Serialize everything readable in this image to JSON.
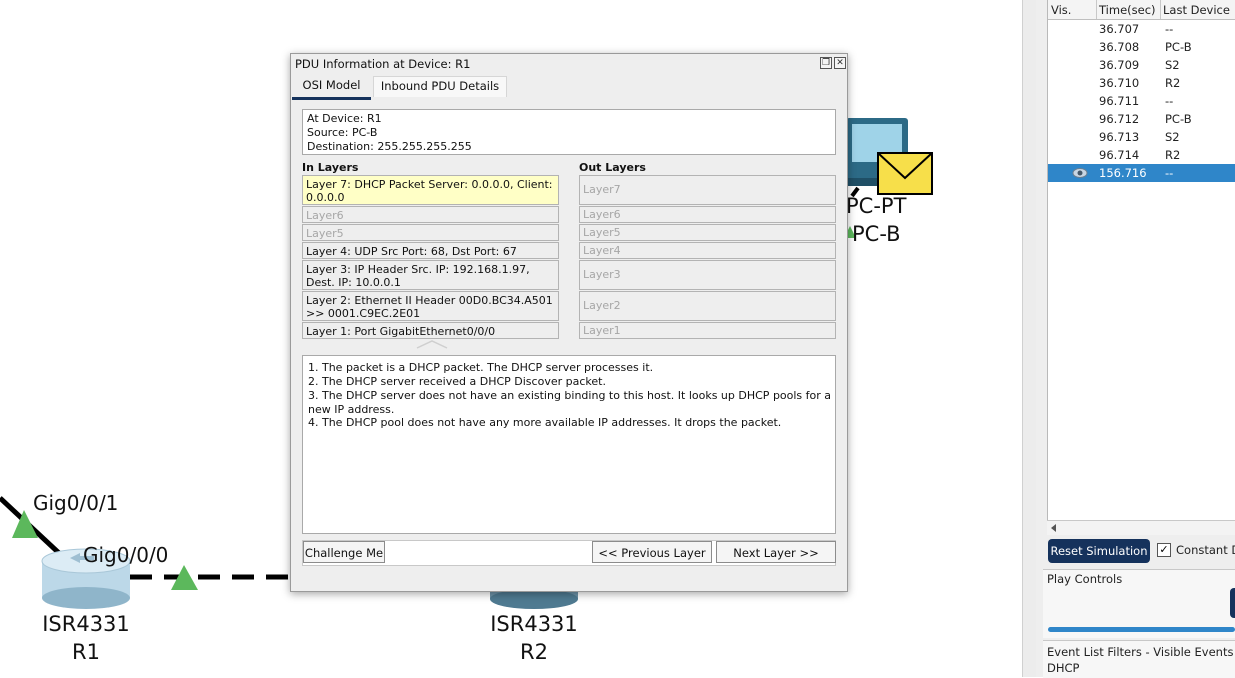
{
  "topology": {
    "devices": [
      {
        "model": "ISR4331",
        "name": "R1"
      },
      {
        "model": "ISR4331",
        "name": "R2"
      },
      {
        "model": "PC-PT",
        "name": "PC-B"
      }
    ],
    "ports": {
      "gig001": "Gig0/0/1",
      "gig000": "Gig0/0/0"
    },
    "colors": {
      "link": "#000000",
      "port_up": "#5cb85c",
      "router": "#9fc6dc",
      "envelope": "#f7df4a"
    }
  },
  "dialog": {
    "title": "PDU Information at Device: R1",
    "tabs": {
      "osi": "OSI Model",
      "inbound": "Inbound PDU Details"
    },
    "info": {
      "at_device": "At Device: R1",
      "source": "Source: PC-B",
      "destination": "Destination: 255.255.255.255"
    },
    "in_header": "In Layers",
    "out_header": "Out Layers",
    "in_layers": [
      "Layer 7: DHCP Packet Server: 0.0.0.0, Client: 0.0.0.0",
      "Layer6",
      "Layer5",
      "Layer 4: UDP Src Port: 68, Dst Port: 67",
      "Layer 3: IP Header Src. IP: 192.168.1.97, Dest. IP: 10.0.0.1",
      "Layer 2: Ethernet II Header 00D0.BC34.A501 >> 0001.C9EC.2E01",
      "Layer 1: Port GigabitEthernet0/0/0"
    ],
    "out_layers": [
      "Layer7",
      "Layer6",
      "Layer5",
      "Layer4",
      "Layer3",
      "Layer2",
      "Layer1"
    ],
    "explanation": [
      "1. The packet is a DHCP packet. The DHCP server processes it.",
      "2. The DHCP server received a DHCP Discover packet.",
      "3. The DHCP server does not have an existing binding to this host. It looks up DHCP pools for a new IP address.",
      "4. The DHCP pool does not have any more available IP addresses. It drops the packet."
    ],
    "buttons": {
      "challenge": "Challenge Me",
      "prev": "<< Previous Layer",
      "next": "Next Layer >>"
    }
  },
  "event_list": {
    "columns": [
      "Vis.",
      "Time(sec)",
      "Last Device"
    ],
    "rows": [
      {
        "time": "36.707",
        "last": "--"
      },
      {
        "time": "36.708",
        "last": "PC-B"
      },
      {
        "time": "36.709",
        "last": "S2"
      },
      {
        "time": "36.710",
        "last": "R2"
      },
      {
        "time": "96.711",
        "last": "--"
      },
      {
        "time": "96.712",
        "last": "PC-B"
      },
      {
        "time": "96.713",
        "last": "S2"
      },
      {
        "time": "96.714",
        "last": "R2"
      },
      {
        "time": "156.716",
        "last": "--",
        "selected": true
      }
    ],
    "reset_label": "Reset Simulation",
    "constant_label": "Constant D",
    "play_controls": "Play Controls",
    "filters_label": "Event List Filters - Visible Events",
    "filters_value": "DHCP"
  }
}
